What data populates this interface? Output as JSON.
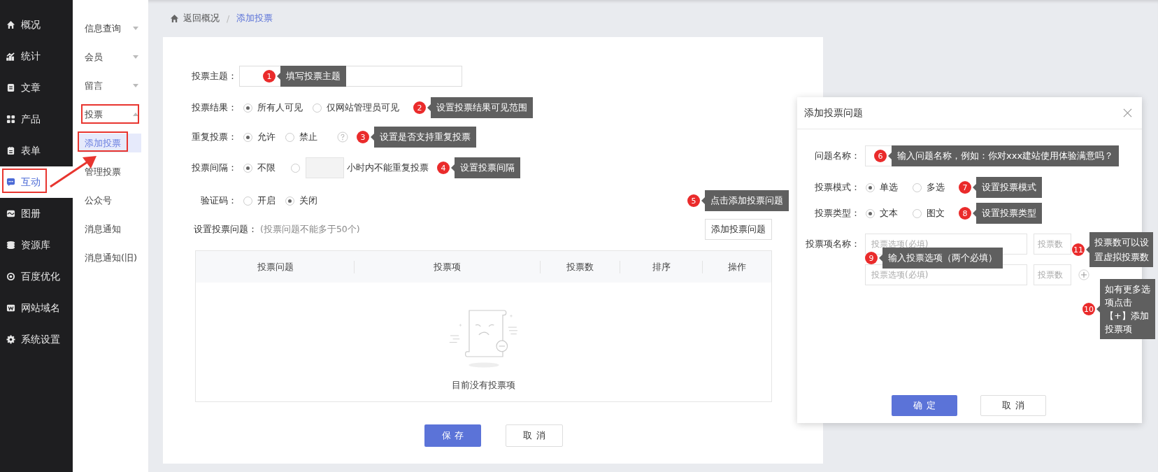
{
  "main_nav": [
    {
      "label": "概况",
      "selected": false
    },
    {
      "label": "统计",
      "selected": false
    },
    {
      "label": "文章",
      "selected": false
    },
    {
      "label": "产品",
      "selected": false
    },
    {
      "label": "表单",
      "selected": false
    },
    {
      "label": "互动",
      "selected": true
    },
    {
      "label": "图册",
      "selected": false
    },
    {
      "label": "资源库",
      "selected": false
    },
    {
      "label": "百度优化",
      "selected": false
    },
    {
      "label": "网站域名",
      "selected": false
    },
    {
      "label": "系统设置",
      "selected": false
    }
  ],
  "sub_nav": [
    {
      "label": "信息查询",
      "kind": "group",
      "expanded": false,
      "selected": false
    },
    {
      "label": "会员",
      "kind": "group",
      "expanded": false,
      "selected": false
    },
    {
      "label": "留言",
      "kind": "group",
      "expanded": false,
      "selected": false
    },
    {
      "label": "投票",
      "kind": "group",
      "expanded": true,
      "selected": false
    },
    {
      "label": "添加投票",
      "kind": "link",
      "selected": true
    },
    {
      "label": "管理投票",
      "kind": "link",
      "selected": false
    },
    {
      "label": "公众号",
      "kind": "link",
      "selected": false
    },
    {
      "label": "消息通知",
      "kind": "link",
      "selected": false
    },
    {
      "label": "消息通知(旧)",
      "kind": "link",
      "selected": false
    }
  ],
  "breadcrumb": {
    "back": "返回概况",
    "separator": "/",
    "current": "添加投票"
  },
  "form": {
    "topic": {
      "label": "投票主题：",
      "callout": {
        "number": "1",
        "text": "填写投票主题"
      }
    },
    "result": {
      "label": "投票结果：",
      "options": [
        {
          "label": "所有人可见",
          "selected": true
        },
        {
          "label": "仅网站管理员可见",
          "selected": false
        }
      ],
      "callout": {
        "number": "2",
        "text": "设置投票结果可见范围"
      }
    },
    "repeat": {
      "label": "重复投票：",
      "options": [
        {
          "label": "允许",
          "selected": true
        },
        {
          "label": "禁止",
          "selected": false
        }
      ],
      "callout": {
        "number": "3",
        "text": "设置是否支持重复投票"
      }
    },
    "interval": {
      "label": "投票间隔：",
      "options": [
        {
          "label": "不限",
          "selected": true
        }
      ],
      "custom": {
        "selected": false,
        "suffix": "小时内不能重复投票"
      },
      "callout": {
        "number": "4",
        "text": "设置投票间隔"
      }
    },
    "captcha": {
      "label": "验证码：",
      "options": [
        {
          "label": "开启",
          "selected": false
        },
        {
          "label": "关闭",
          "selected": true
        }
      ],
      "callout": {
        "number": "5",
        "text": "点击添加投票问题"
      }
    },
    "questions": {
      "label": "设置投票问题：",
      "hint": "(投票问题不能多于50个)",
      "add_button": "添加投票问题"
    }
  },
  "table": {
    "columns": [
      "投票问题",
      "投票项",
      "投票数",
      "排序",
      "操作"
    ],
    "empty_text": "目前没有投票项"
  },
  "actions": [
    "保存",
    "取消"
  ],
  "dialog": {
    "title": "添加投票问题",
    "question": {
      "label": "问题名称：",
      "callout": {
        "number": "6",
        "text": "输入问题名称，例如：你对xxx建站使用体验满意吗？"
      }
    },
    "mode": {
      "label": "投票模式：",
      "options": [
        {
          "label": "单选",
          "selected": true
        },
        {
          "label": "多选",
          "selected": false
        }
      ],
      "callout": {
        "number": "7",
        "text": "设置投票模式"
      }
    },
    "type": {
      "label": "投票类型：",
      "options": [
        {
          "label": "文本",
          "selected": true
        },
        {
          "label": "图文",
          "selected": false
        }
      ],
      "callout": {
        "number": "8",
        "text": "设置投票类型"
      }
    },
    "items": {
      "label": "投票项名称：",
      "rows": [
        {
          "placeholder": "投票选项(必填)",
          "count_placeholder": "投票数"
        },
        {
          "placeholder": "投票选项(必填)",
          "count_placeholder": "投票数"
        }
      ],
      "count_callout": {
        "number": "11",
        "text": "投票数可以设置虚拟投票数"
      },
      "option_callout": {
        "number": "9",
        "text": "输入投票选项（两个必填）"
      },
      "add_callout": {
        "number": "10",
        "text": "如有更多选项点击【+】添加投票项"
      }
    },
    "buttons": [
      "确定",
      "取消"
    ]
  }
}
